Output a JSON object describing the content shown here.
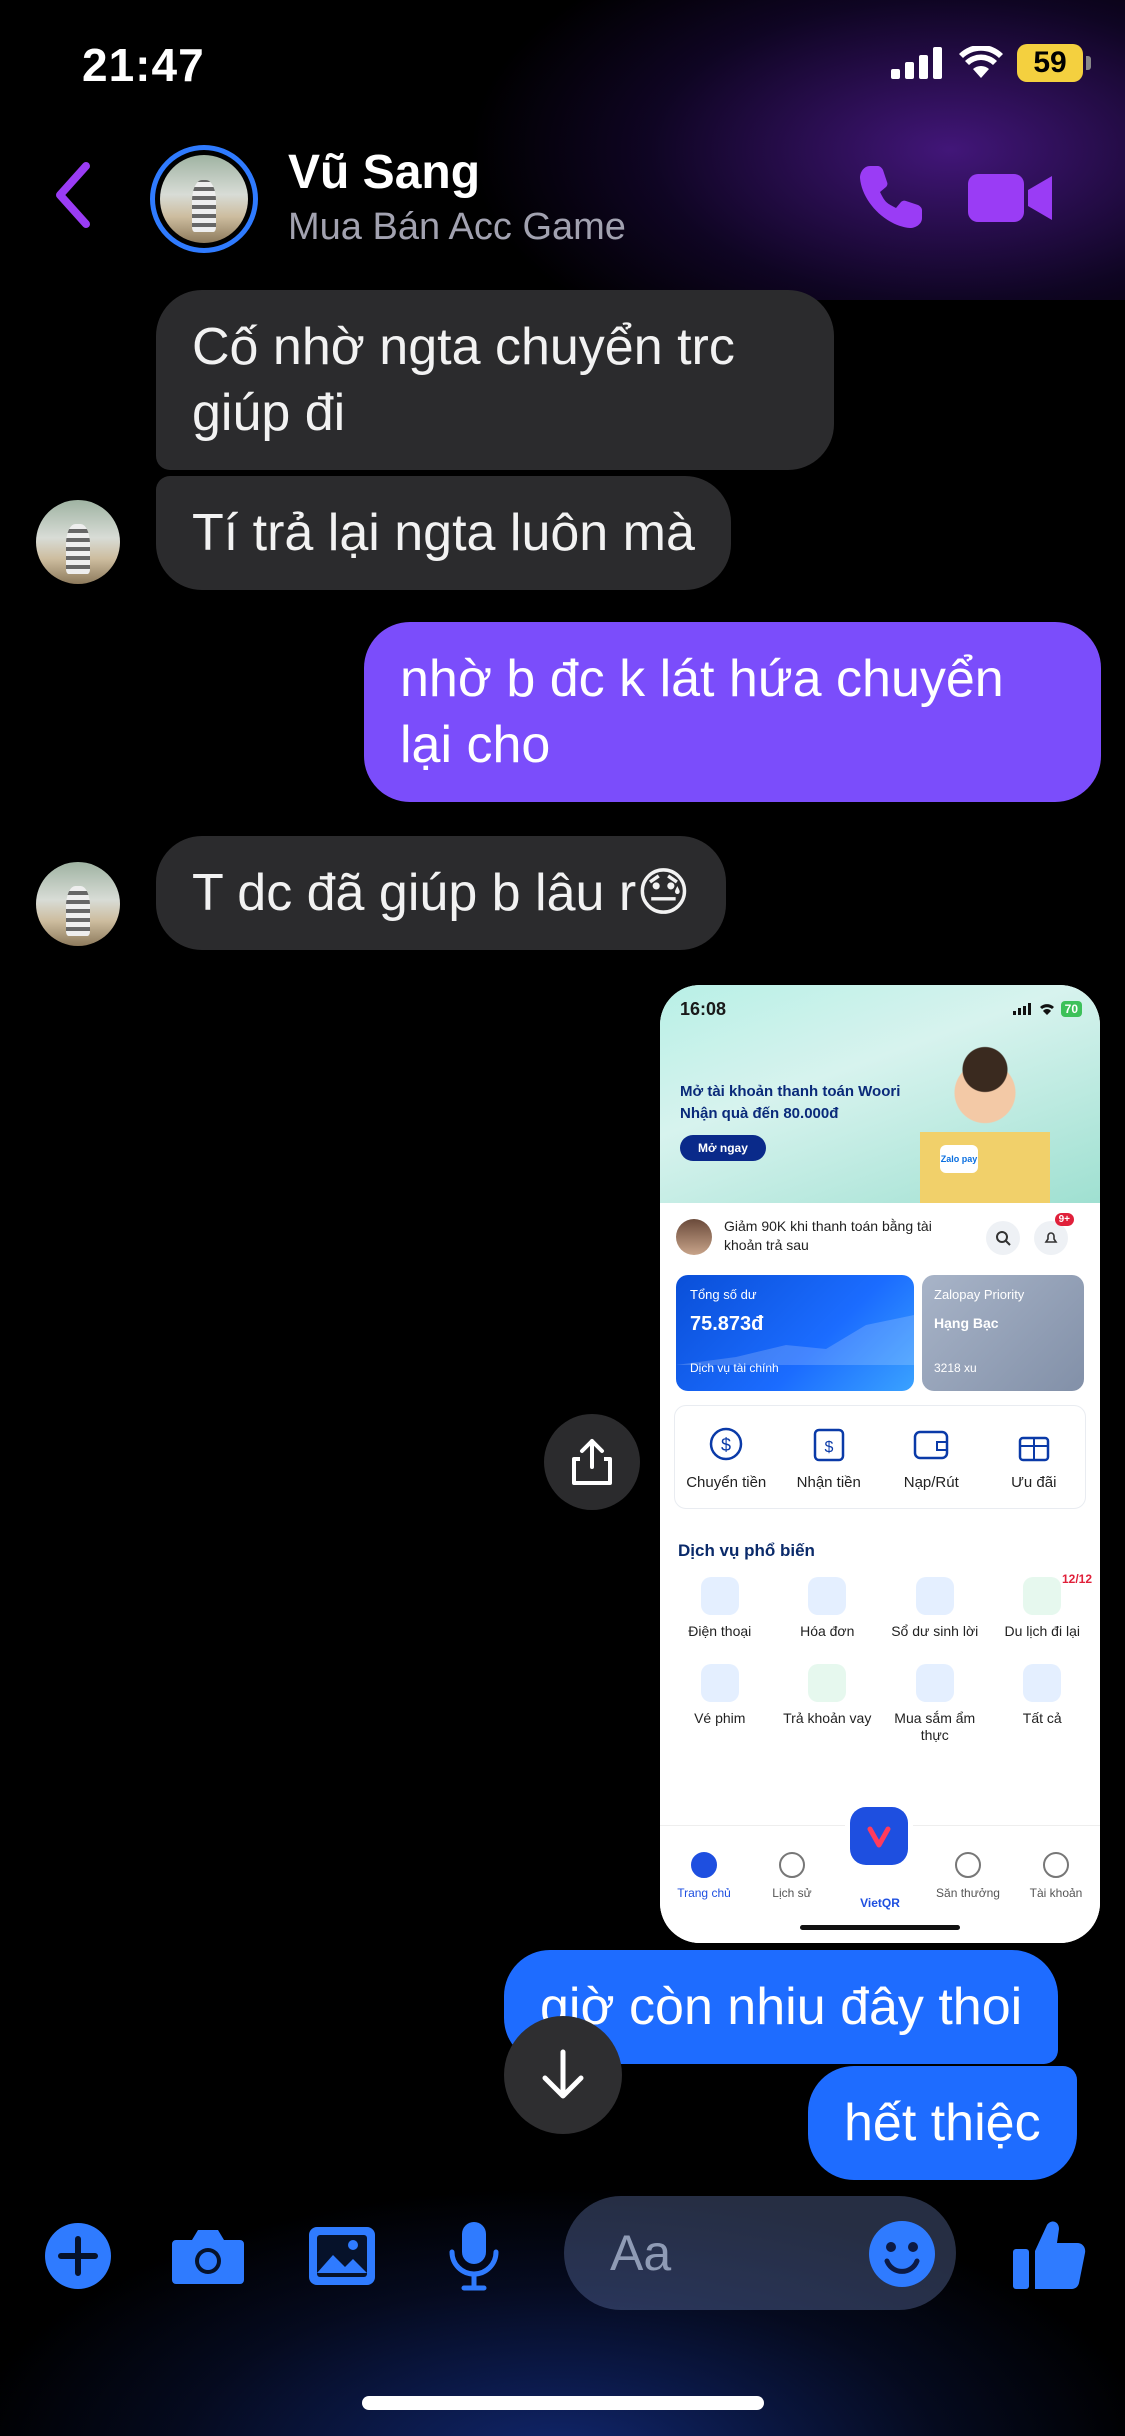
{
  "status_bar": {
    "time": "21:47",
    "battery": "59"
  },
  "header": {
    "contact_name": "Vũ Sang",
    "contact_subtitle": "Mua Bán Acc Game"
  },
  "messages": [
    {
      "side": "in",
      "text": "Cố nhờ ngta chuyển trc giúp đi"
    },
    {
      "side": "in",
      "text": "Tí trả lại ngta luôn mà"
    },
    {
      "side": "out",
      "text": "nhờ b đc k lát hứa chuyển lại cho"
    },
    {
      "side": "in",
      "text": "T dc đã giúp b lâu r😓"
    },
    {
      "side": "out",
      "text": "giờ còn nhiu đây thoi"
    },
    {
      "side": "out",
      "text": "hết thiệc"
    }
  ],
  "screenshot": {
    "time": "16:08",
    "battery": "70",
    "promo_line1": "Mở tài khoản thanh toán Woori",
    "promo_line2": "Nhận quà đến 80.000đ",
    "open_button": "Mở ngay",
    "zalo_badge": "Zalo pay",
    "promo_text": "Giảm 90K khi thanh toán bằng tài khoản trả sau",
    "notif_count": "9+",
    "balance_label": "Tổng số dư",
    "balance_value": "75.873đ",
    "finance_service": "Dịch vụ tài chính",
    "priority_label": "Zalopay Priority",
    "priority_tier": "Hạng Bạc",
    "coins": "3218 xu",
    "quick_actions": [
      "Chuyển tiền",
      "Nhận tiền",
      "Nạp/Rút",
      "Ưu đãi"
    ],
    "services_title": "Dịch vụ phổ biến",
    "services": [
      "Điện thoại",
      "Hóa đơn",
      "Sổ dư sinh lời",
      "Du lịch đi lại",
      "Vé phim",
      "Trả khoản vay",
      "Mua sắm ẩm thực",
      "Tất cả"
    ],
    "travel_badge": "12/12",
    "nav": [
      "Trang chủ",
      "Lịch sử",
      "VietQR",
      "Săn thưởng",
      "Tài khoản"
    ]
  },
  "composer": {
    "placeholder": "Aa"
  },
  "colors": {
    "accent_purple": "#8a3cf0",
    "accent_blue": "#1e6cff",
    "bubble_in": "#2b2b2d",
    "bubble_out_purple": "#7b4dfb"
  },
  "icons": [
    "back-chevron-icon",
    "phone-icon",
    "video-camera-icon",
    "share-icon",
    "arrow-down-icon",
    "plus-icon",
    "camera-icon",
    "image-icon",
    "microphone-icon",
    "emoji-icon",
    "thumbs-up-icon"
  ]
}
